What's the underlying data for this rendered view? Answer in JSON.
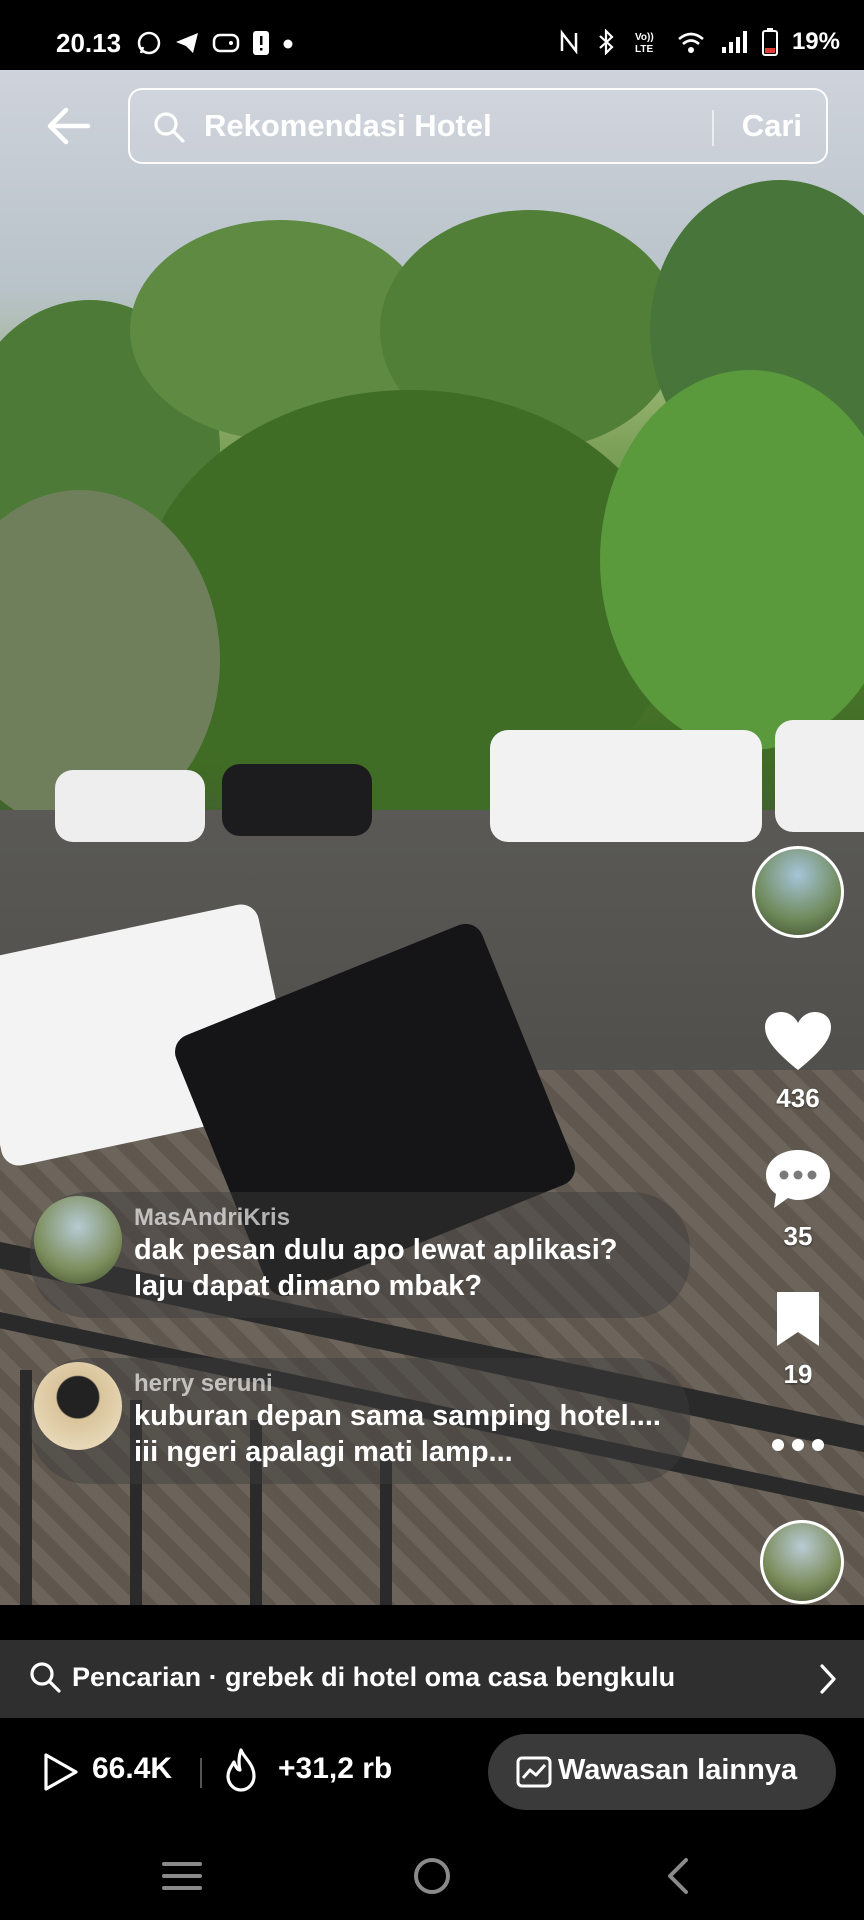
{
  "status_bar": {
    "time": "20.13",
    "battery": "19%",
    "left_icons": [
      "whatsapp-icon",
      "telegram-icon",
      "game-icon",
      "sim-alert-icon",
      "dot-icon"
    ],
    "right_icons": [
      "nfc-icon",
      "bluetooth-icon",
      "volte-icon",
      "wifi-icon",
      "signal-icon",
      "battery-icon"
    ]
  },
  "search": {
    "query": "Rekomendasi Hotel",
    "submit_label": "Cari"
  },
  "actions": {
    "likes": "436",
    "comments": "35",
    "saves": "19"
  },
  "comments": [
    {
      "user": "MasAndriKris",
      "text": "dak pesan dulu apo lewat aplikasi? laju dapat dimano mbak?"
    },
    {
      "user": "herry seruni",
      "text": "kuburan depan sama samping hotel.... iii ngeri apalagi mati lamp..."
    }
  ],
  "suggestion": {
    "text": "Pencarian · grebek di hotel oma casa bengkulu"
  },
  "stats": {
    "views": "66.4K",
    "trend": "+31,2 rb",
    "insight_label": "Wawasan lainnya"
  },
  "colors": {
    "background": "#000000",
    "bar": "#2f2f2f",
    "button": "#3a3a3a",
    "battery_low": "#e53935"
  }
}
